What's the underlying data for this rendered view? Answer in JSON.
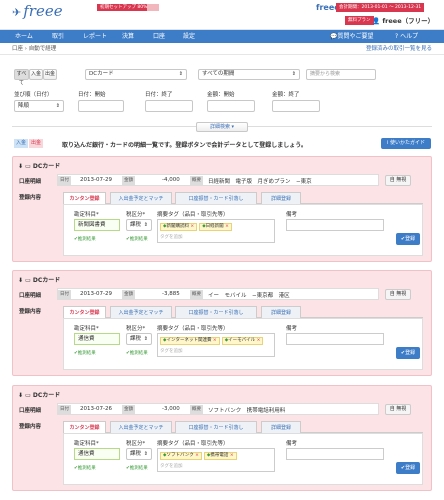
{
  "header": {
    "logo": "freee",
    "setup_label": "初期セットアップ 80%",
    "setup_progress": 0.8,
    "brand_right": "freee",
    "period": "会計期間：2013-01-01 ～ 2013-12-31",
    "plan": "無料プラン",
    "user": "freee（フリー）"
  },
  "nav": {
    "items": [
      "ホーム",
      "取引",
      "レポート",
      "決算",
      "口座",
      "設定"
    ],
    "help_link": "質問やご要望",
    "help": "ヘルプ"
  },
  "breadcrumb": "口座 › 自動で経理",
  "reg_link": "登録済みの取引一覧を見る",
  "filter": {
    "seg": [
      "すべて",
      "入金",
      "出金"
    ],
    "account": "DCカード",
    "period": "すべての期間",
    "search_placeholder": "摘要から検索",
    "sort_label": "並び順（日付）",
    "sort_value": "降順",
    "date_start_label": "日付：開始",
    "date_end_label": "日付：終了",
    "amount_start_label": "金額：開始",
    "amount_end_label": "金額：終了",
    "detail_search": "詳細検索"
  },
  "legend": {
    "in": "入金",
    "out": "出金",
    "desc": "取り込んだ銀行・カードの明細一覧です。登録ボタンで会計データとして登録しましょう。",
    "guide": "使いかたガイド"
  },
  "cards": [
    {
      "title": "DCカード",
      "date": "2013-07-29",
      "amount": "-4,000",
      "summary": "日経新聞　電子版　月ぎめプラン　−東京",
      "account": "新聞図書費",
      "tax": "課税",
      "tags": [
        {
          "s": "新聞購読料",
          "k": "item"
        },
        {
          "s": "日経新聞",
          "k": "partner"
        }
      ]
    },
    {
      "title": "DCカード",
      "date": "2013-07-29",
      "amount": "-3,885",
      "summary": "イー　モバイル　−東京都　港区",
      "account": "通信費",
      "tax": "課税",
      "tags": [
        {
          "s": "インターネット関連費",
          "k": "item"
        },
        {
          "s": "イーモバイル",
          "k": "partner"
        }
      ]
    },
    {
      "title": "DCカード",
      "date": "2013-07-26",
      "amount": "-3,000",
      "summary": "ソフトバンク　携帯電話利用料",
      "account": "通信費",
      "tax": "課税",
      "tags": [
        {
          "s": "ソフトバンク",
          "k": "partner"
        },
        {
          "s": "携帯電話",
          "k": "item"
        }
      ]
    }
  ],
  "card_labels": {
    "bank_detail": "口座明細",
    "date": "日付",
    "amount": "金額",
    "summary": "概要",
    "delete": "自 無視",
    "reg_content": "登録内容",
    "tabs": [
      "カンタン登録",
      "入出金予定とマッチ",
      "口座振替・カード引落し",
      "詳細登録"
    ],
    "acc_label": "勘定科目*",
    "tax_label": "税区分*",
    "tag_label": "摘要タグ（品目・取引先等）",
    "memo_label": "備考",
    "tag_placeholder": "タグを追加",
    "estimate": "✔推測結果",
    "register": "✔登録"
  }
}
